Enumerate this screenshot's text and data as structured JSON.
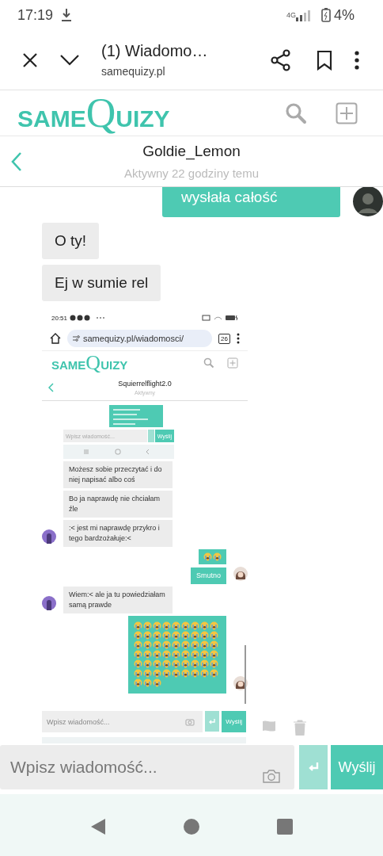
{
  "status_bar": {
    "time": "17:19",
    "network": "4G",
    "battery": "4%"
  },
  "browser": {
    "title": "(1) Wiadomo…",
    "url": "samequizy.pl"
  },
  "logo": {
    "small": "SAME",
    "big": "Q",
    "rest": "UIZY"
  },
  "chat": {
    "name": "Goldie_Lemon",
    "status": "Aktywny 22 godziny temu"
  },
  "messages": [
    {
      "kind": "text",
      "outgoing": true,
      "avatar": true,
      "text": "wysłała całość"
    },
    {
      "kind": "text",
      "outgoing": false,
      "avatar": false,
      "text": "O ty!"
    },
    {
      "kind": "text",
      "outgoing": false,
      "avatar": false,
      "text": "Ej w sumie rel"
    },
    {
      "kind": "screenshot",
      "outgoing": false
    }
  ],
  "screenshot": {
    "time": "20:51",
    "logo": {
      "small": "SAME",
      "big": "Q",
      "rest": "UIZY"
    },
    "url": "samequizy.pl/wiadomosci/",
    "tab_count": "26",
    "name": "Squierrelflight2.0",
    "status": "Aktywny",
    "messages": [
      {
        "kind": "blurred",
        "outgoing": true,
        "avatar": false
      },
      {
        "kind": "input_strip",
        "outgoing": false,
        "avatar": false,
        "placeholder": "Wpisz wiadomość...",
        "send": "Wyślij"
      },
      {
        "kind": "nav_strip",
        "outgoing": false,
        "avatar": false
      },
      {
        "kind": "text",
        "outgoing": false,
        "avatar": false,
        "text": "Możesz sobie przeczytać i do niej napisać albo coś"
      },
      {
        "kind": "text",
        "outgoing": false,
        "avatar": false,
        "text": "Bo ja naprawdę nie chciałam źle"
      },
      {
        "kind": "text",
        "outgoing": false,
        "avatar": true,
        "text": ":< jest mi naprawdę przykro i tego bardzożałuje:<"
      },
      {
        "kind": "emoji",
        "outgoing": true,
        "avatar": false,
        "emojis": [
          {
            "kind": "crying_face"
          },
          {
            "kind": "crying_face"
          }
        ]
      },
      {
        "kind": "text",
        "outgoing": true,
        "avatar": true,
        "text": "Smutno"
      },
      {
        "kind": "text",
        "outgoing": false,
        "avatar": true,
        "text": "Wiem:< ale ja tu powiedziałam samą prawde"
      },
      {
        "kind": "emoji",
        "outgoing": true,
        "avatar": true,
        "emojis": [
          {
            "kind": "crying_face"
          },
          {
            "kind": "crying_face"
          },
          {
            "kind": "crying_face"
          },
          {
            "kind": "crying_face"
          },
          {
            "kind": "crying_face"
          },
          {
            "kind": "crying_face"
          },
          {
            "kind": "crying_face"
          },
          {
            "kind": "crying_face"
          },
          {
            "kind": "crying_face"
          },
          {
            "kind": "crying_face"
          },
          {
            "kind": "crying_face"
          },
          {
            "kind": "crying_face"
          },
          {
            "kind": "crying_face"
          },
          {
            "kind": "crying_face"
          },
          {
            "kind": "crying_face"
          },
          {
            "kind": "crying_face"
          },
          {
            "kind": "crying_face"
          },
          {
            "kind": "crying_face"
          },
          {
            "kind": "crying_face"
          },
          {
            "kind": "crying_face"
          },
          {
            "kind": "crying_face"
          },
          {
            "kind": "crying_face"
          },
          {
            "kind": "crying_face"
          },
          {
            "kind": "crying_face"
          },
          {
            "kind": "crying_face"
          },
          {
            "kind": "crying_face"
          },
          {
            "kind": "crying_face"
          },
          {
            "kind": "crying_face"
          },
          {
            "kind": "crying_face"
          },
          {
            "kind": "crying_face"
          },
          {
            "kind": "crying_face"
          },
          {
            "kind": "crying_face"
          },
          {
            "kind": "crying_face"
          },
          {
            "kind": "crying_face"
          },
          {
            "kind": "crying_face"
          },
          {
            "kind": "crying_face"
          },
          {
            "kind": "crying_face"
          },
          {
            "kind": "crying_face"
          },
          {
            "kind": "crying_face"
          },
          {
            "kind": "crying_face"
          },
          {
            "kind": "crying_face"
          },
          {
            "kind": "crying_face"
          },
          {
            "kind": "crying_face"
          },
          {
            "kind": "crying_face"
          },
          {
            "kind": "crying_face"
          },
          {
            "kind": "crying_face"
          },
          {
            "kind": "crying_face"
          },
          {
            "kind": "crying_face"
          },
          {
            "kind": "crying_face"
          },
          {
            "kind": "crying_face"
          },
          {
            "kind": "crying_face"
          },
          {
            "kind": "crying_face"
          },
          {
            "kind": "crying_face"
          },
          {
            "kind": "crying_face"
          },
          {
            "kind": "crying_face"
          },
          {
            "kind": "crying_face"
          },
          {
            "kind": "crying_face"
          }
        ]
      }
    ],
    "input": {
      "placeholder": "Wpisz wiadomość...",
      "send": "Wyślij"
    }
  },
  "input": {
    "placeholder": "Wpisz wiadomość...",
    "send": "Wyślij"
  }
}
